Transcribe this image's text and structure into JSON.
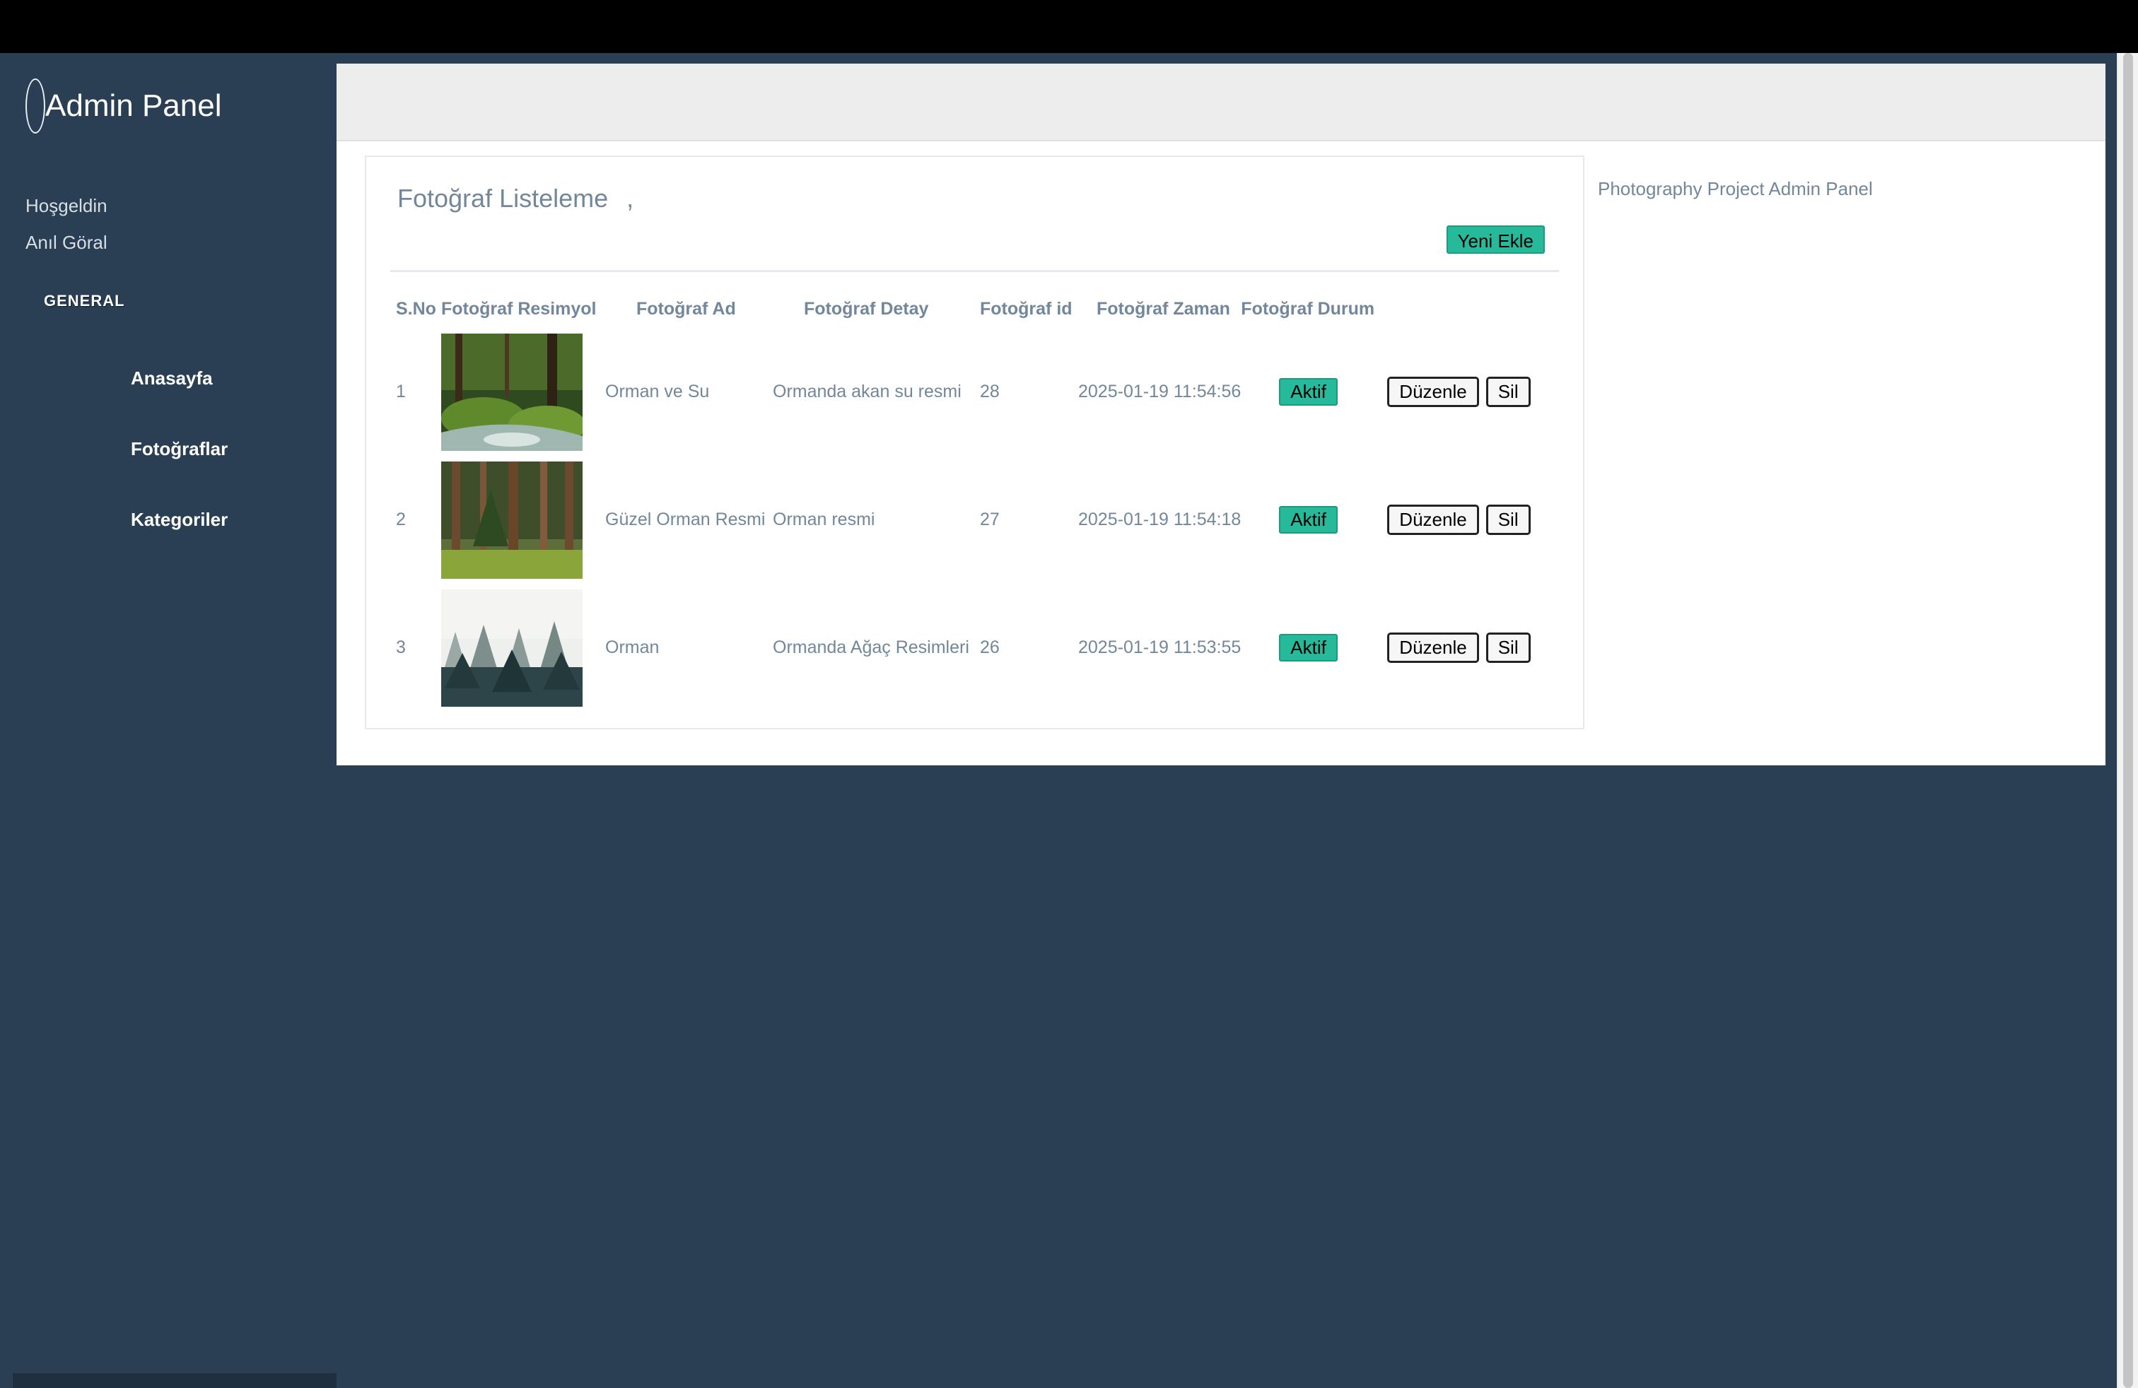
{
  "sidebar": {
    "brand": "Admin Panel",
    "welcome": "Hoşgeldin",
    "user_name": "Anıl Göral",
    "section": "GENERAL",
    "items": [
      {
        "label": "Anasayfa"
      },
      {
        "label": "Fotoğraflar"
      },
      {
        "label": "Kategoriler"
      }
    ]
  },
  "panel": {
    "title": "Fotoğraf Listeleme",
    "title_suffix": ",",
    "new_button": "Yeni Ekle"
  },
  "table": {
    "headers": [
      "S.No",
      "Fotoğraf Resimyol",
      "Fotoğraf Ad",
      "Fotoğraf Detay",
      "Fotoğraf id",
      "Fotoğraf Zaman",
      "Fotoğraf Durum"
    ],
    "rows": [
      {
        "sno": "1",
        "image": "forest-stream-photo",
        "ad": "Orman ve Su",
        "detay": "Ormanda akan su resmi",
        "id": "28",
        "zaman": "2025-01-19 11:54:56",
        "durum": "Aktif",
        "edit": "Düzenle",
        "delete": "Sil"
      },
      {
        "sno": "2",
        "image": "pine-forest-photo",
        "ad": "Güzel Orman Resmi",
        "detay": "Orman resmi",
        "id": "27",
        "zaman": "2025-01-19 11:54:18",
        "durum": "Aktif",
        "edit": "Düzenle",
        "delete": "Sil"
      },
      {
        "sno": "3",
        "image": "foggy-forest-photo",
        "ad": "Orman",
        "detay": "Ormanda Ağaç Resimleri",
        "id": "26",
        "zaman": "2025-01-19 11:53:55",
        "durum": "Aktif",
        "edit": "Düzenle",
        "delete": "Sil"
      }
    ]
  },
  "footer": {
    "text": "Photography Project Admin Panel"
  },
  "colors": {
    "sidebar": "#2a3f54",
    "accent": "#26b99a",
    "text": "#73879c"
  }
}
